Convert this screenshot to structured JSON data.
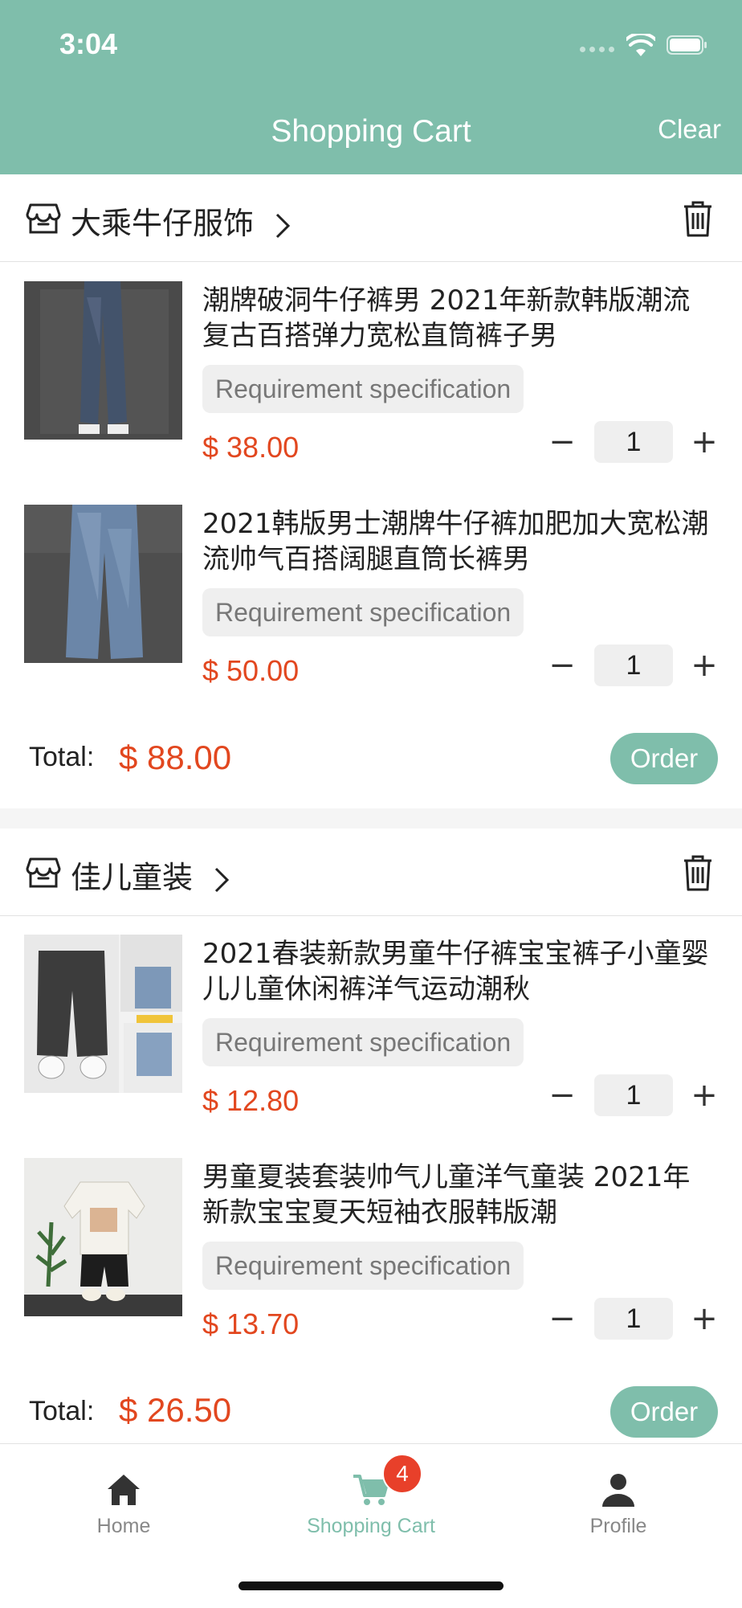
{
  "status": {
    "time": "3:04"
  },
  "header": {
    "title": "Shopping Cart",
    "clear_label": "Clear"
  },
  "colors": {
    "accent": "#7fbeab",
    "price": "#e2471f",
    "badge": "#e8402a"
  },
  "stores": [
    {
      "name": "大乘牛仔服饰",
      "items": [
        {
          "title": "潮牌破洞牛仔裤男 2021年新款韩版潮流复古百搭弹力宽松直筒裤子男",
          "spec": "Requirement specification",
          "price": "$ 38.00",
          "qty": "1",
          "minus": "−",
          "plus": "+"
        },
        {
          "title": "2021韩版男士潮牌牛仔裤加肥加大宽松潮流帅气百搭阔腿直筒长裤男",
          "spec": "Requirement specification",
          "price": "$ 50.00",
          "qty": "1",
          "minus": "−",
          "plus": "+"
        }
      ],
      "total_label": "Total:",
      "total": "$ 88.00",
      "order_label": "Order"
    },
    {
      "name": "佳儿童装",
      "items": [
        {
          "title": "2021春装新款男童牛仔裤宝宝裤子小童婴儿儿童休闲裤洋气运动潮秋",
          "spec": "Requirement specification",
          "price": "$ 12.80",
          "qty": "1",
          "minus": "−",
          "plus": "+"
        },
        {
          "title": "男童夏装套装帅气儿童洋气童装 2021年新款宝宝夏天短袖衣服韩版潮",
          "spec": "Requirement specification",
          "price": "$ 13.70",
          "qty": "1",
          "minus": "−",
          "plus": "+"
        }
      ],
      "total_label": "Total:",
      "total": "$ 26.50",
      "order_label": "Order"
    }
  ],
  "tabbar": {
    "home": "Home",
    "cart": "Shopping Cart",
    "cart_badge": "4",
    "profile": "Profile",
    "active": "cart"
  }
}
